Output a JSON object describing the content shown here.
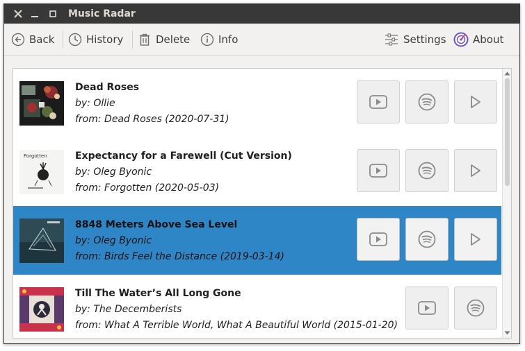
{
  "window": {
    "title": "Music Radar"
  },
  "toolbar": {
    "back_label": "Back",
    "history_label": "History",
    "delete_label": "Delete",
    "info_label": "Info",
    "settings_label": "Settings",
    "about_label": "About"
  },
  "tracks": [
    {
      "title": "Dead Roses",
      "by": "by: Ollie",
      "from": "from: Dead Roses (2020-07-31)"
    },
    {
      "title": "Expectancy for a Farewell (Cut Version)",
      "by": "by: Oleg Byonic",
      "from": "from: Forgotten (2020-05-03)",
      "cover_text": "Forgotten"
    },
    {
      "title": "8848 Meters Above Sea Level",
      "by": "by: Oleg Byonic",
      "from": "from: Birds Feel the Distance (2019-03-14)"
    },
    {
      "title": "Till The Water’s All Long Gone",
      "by": "by: The Decemberists",
      "from": "from: What A Terrible World, What A Beautiful World (2015-01-20)"
    }
  ],
  "colors": {
    "titlebar": "#383838",
    "selection": "#2f86c7",
    "about_icon": "#6b4fd6"
  },
  "icons": {
    "youtube": "youtube-icon",
    "spotify": "spotify-icon",
    "play": "play-icon"
  }
}
